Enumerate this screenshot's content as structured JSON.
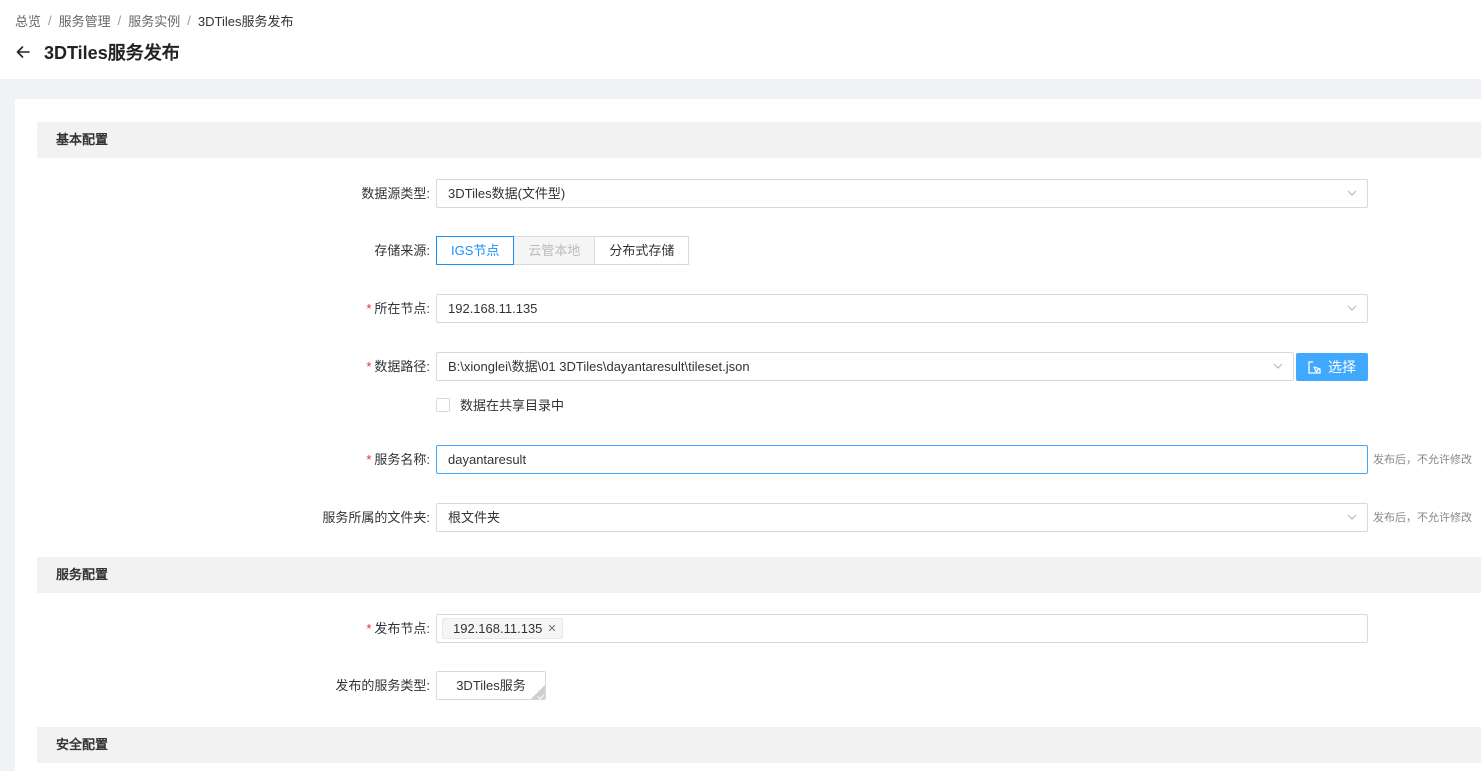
{
  "breadcrumb": {
    "items": [
      "总览",
      "服务管理",
      "服务实例",
      "3DTiles服务发布"
    ],
    "separator": "/"
  },
  "page": {
    "title": "3DTiles服务发布",
    "back_icon": "arrow-left-icon"
  },
  "sections": {
    "basic": "基本配置",
    "service": "服务配置",
    "security": "安全配置"
  },
  "form": {
    "datasource_type": {
      "label": "数据源类型:",
      "value": "3DTiles数据(文件型)"
    },
    "storage_source": {
      "label": "存储来源:",
      "options": [
        "IGS节点",
        "云管本地",
        "分布式存储"
      ],
      "selected": "IGS节点",
      "disabled": "云管本地"
    },
    "node": {
      "label": "所在节点:",
      "value": "192.168.11.135",
      "required": "*"
    },
    "data_path": {
      "label": "数据路径:",
      "value": "B:\\xionglei\\数据\\01 3DTiles\\dayantaresult\\tileset.json",
      "required": "*",
      "choose_label": "选择"
    },
    "shared_dir": {
      "label": "数据在共享目录中",
      "checked": false
    },
    "service_name": {
      "label": "服务名称:",
      "value": "dayantaresult",
      "required": "*",
      "hint": "发布后，不允许修改"
    },
    "folder": {
      "label": "服务所属的文件夹:",
      "value": "根文件夹",
      "hint": "发布后，不允许修改"
    },
    "publish_node": {
      "label": "发布节点:",
      "tag": "192.168.11.135",
      "required": "*"
    },
    "service_type": {
      "label": "发布的服务类型:",
      "value": "3DTiles服务"
    }
  },
  "colors": {
    "primary": "#1890ff",
    "primary_button": "#40a9ff",
    "required": "#f5222d"
  }
}
